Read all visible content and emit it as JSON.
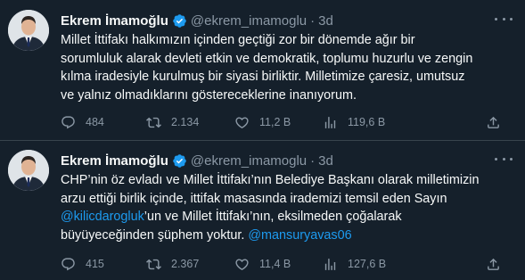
{
  "tweets": [
    {
      "author_name": "Ekrem İmamoğlu",
      "handle": "@ekrem_imamoglu",
      "separator": "·",
      "time": "3d",
      "text_lines": [
        [
          {
            "t": "Millet İttifakı halkımızın içinden geçtiği zor bir dönemde ağır bir"
          }
        ],
        [
          {
            "t": "sorumluluk alarak devleti etkin ve demokratik, toplumu huzurlu ve zengin"
          }
        ],
        [
          {
            "t": "kılma iradesiyle kurulmuş bir siyasi birliktir. Milletimize çaresiz, umutsuz"
          }
        ],
        [
          {
            "t": "ve yalnız olmadıklarını göstereceklerine inanıyorum."
          }
        ]
      ],
      "replies": "484",
      "retweets": "2.134",
      "likes": "11,2 B",
      "views": "119,6 B"
    },
    {
      "author_name": "Ekrem İmamoğlu",
      "handle": "@ekrem_imamoglu",
      "separator": "·",
      "time": "3d",
      "text_lines": [
        [
          {
            "t": "CHP’nin öz evladı ve Millet İttifakı’nın Belediye Başkanı olarak milletimizin"
          }
        ],
        [
          {
            "t": "arzu ettiği birlik içinde, ittifak masasında irademizi temsil eden Sayın"
          }
        ],
        [
          {
            "t": "@kilicdarogluk",
            "mention": true
          },
          {
            "t": "’un ve Millet İttifakı’nın, eksilmeden çoğalarak"
          }
        ],
        [
          {
            "t": "büyüyeceğinden şüphem yoktur. "
          },
          {
            "t": "@mansuryavas06",
            "mention": true
          }
        ]
      ],
      "replies": "415",
      "retweets": "2.367",
      "likes": "11,4 B",
      "views": "127,6 B"
    }
  ],
  "colors": {
    "background": "#15202b",
    "text": "#f7f9f9",
    "muted": "#8b98a5",
    "link": "#1d9bf0",
    "verified": "#1d9bf0",
    "divider": "#38444d"
  },
  "icons": {
    "reply": "comment-bubble-icon",
    "retweet": "retweet-arrows-icon",
    "like": "heart-icon",
    "views": "bar-chart-icon",
    "share": "share-upload-icon",
    "more": "more-dots-icon",
    "verified": "verified-badge-icon"
  }
}
